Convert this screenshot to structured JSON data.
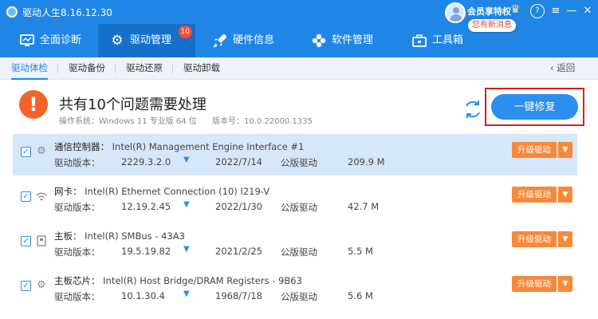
{
  "app": {
    "title": "驱动人生8.16.12.30"
  },
  "user": {
    "vip_label": "会员享特权",
    "message_badge": "您有新消息"
  },
  "window_controls": {
    "help": "?",
    "menu": "≡",
    "minimize": "—",
    "close": "✕"
  },
  "nav": {
    "tabs": [
      {
        "label": "全面诊断",
        "icon": "monitor-icon"
      },
      {
        "label": "驱动管理",
        "icon": "gear-icon",
        "badge": "10"
      },
      {
        "label": "硬件信息",
        "icon": "rocket-icon"
      },
      {
        "label": "软件管理",
        "icon": "grid-icon"
      },
      {
        "label": "工具箱",
        "icon": "toolbox-icon"
      }
    ]
  },
  "subtabs": {
    "items": [
      "驱动体检",
      "驱动备份",
      "驱动还原",
      "驱动卸载"
    ],
    "back": "返回"
  },
  "summary": {
    "title": "共有10个问题需要处理",
    "os": "操作系统：Windows 11 专业版 64 位",
    "version": "版本号：10.0.22000.1335",
    "fix_button": "一键修复"
  },
  "rows": [
    {
      "category": "通信控制器：",
      "name": "Intel(R) Management Engine Interface #1",
      "version_label": "驱动版本：",
      "version": "2229.3.2.0",
      "date": "2022/7/14",
      "type": "公版驱动",
      "size": "209.9 M",
      "action": "升级驱动",
      "icon": "chip-icon"
    },
    {
      "category": "网卡：",
      "name": "Intel(R) Ethernet Connection (10) I219-V",
      "version_label": "驱动版本：",
      "version": "12.19.2.45",
      "date": "2022/1/30",
      "type": "公版驱动",
      "size": "42.7 M",
      "action": "升级驱动",
      "icon": "wifi-icon"
    },
    {
      "category": "主板：",
      "name": "Intel(R) SMBus - 43A3",
      "version_label": "驱动版本：",
      "version": "19.5.19.82",
      "date": "2021/2/25",
      "type": "公版驱动",
      "size": "5.5 M",
      "action": "升级驱动",
      "icon": "board-icon"
    },
    {
      "category": "主板芯片：",
      "name": "Intel(R) Host Bridge/DRAM Registers - 9B63",
      "version_label": "驱动版本：",
      "version": "10.1.30.4",
      "date": "1968/7/18",
      "type": "公版驱动",
      "size": "5.6 M",
      "action": "升级驱动",
      "icon": "chip-icon"
    }
  ],
  "colors": {
    "primary": "#1f86e6",
    "warning": "#f4632c",
    "upgrade": "#f7893b",
    "highlight": "#e11b1b"
  }
}
